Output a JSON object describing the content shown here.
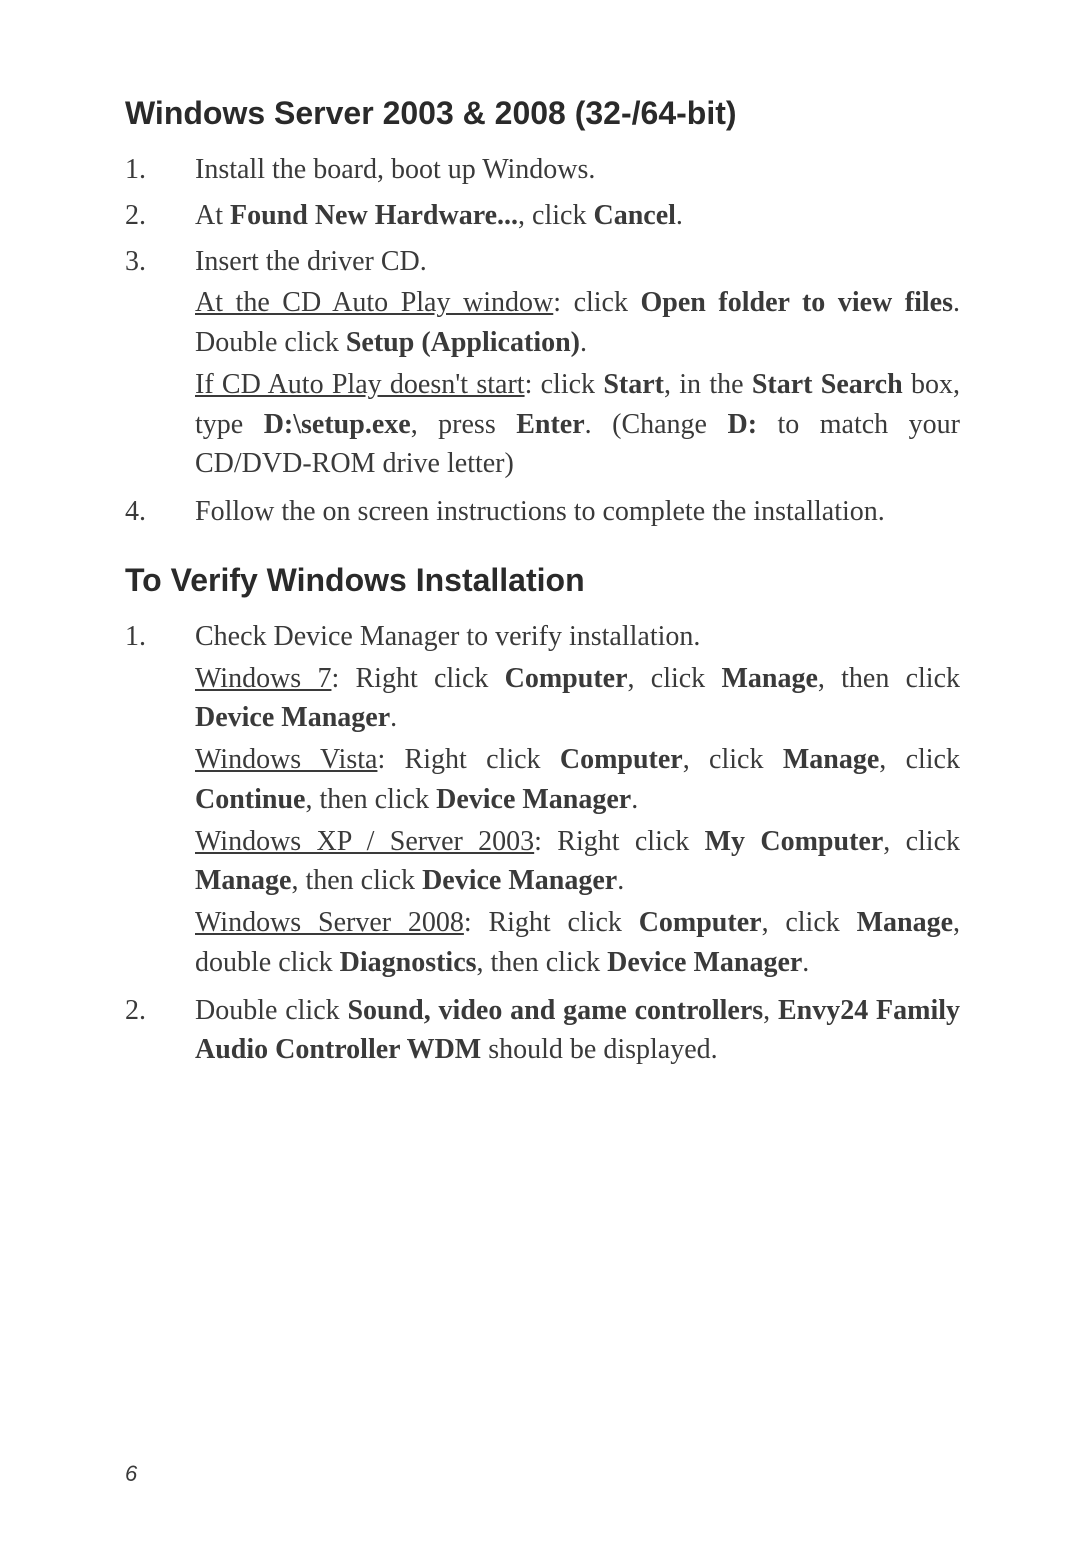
{
  "heading1": "Windows Server 2003 & 2008 (32-/64-bit)",
  "list1": {
    "item1": {
      "num": "1.",
      "text": "Install the board, boot up Windows."
    },
    "item2": {
      "num": "2.",
      "prefix": "At ",
      "bold1": "Found New Hardware...",
      "mid": ", click ",
      "bold2": "Cancel",
      "suffix": "."
    },
    "item3": {
      "num": "3.",
      "line1": "Insert the driver CD.",
      "line2_u": "At the CD Auto Play window",
      "line2_a": ": click ",
      "line2_b1": "Open folder to view files",
      "line2_c": ".  Double click ",
      "line2_b2": "Setup (Application)",
      "line2_d": ".",
      "line3_u": "If CD Auto Play doesn't start",
      "line3_a": ": click ",
      "line3_b1": "Start",
      "line3_b": ", in the ",
      "line3_b2": "Start Search",
      "line3_c": " box, type ",
      "line3_b3": "D:\\setup.exe",
      "line3_d": ", press ",
      "line3_b4": "Enter",
      "line3_e": ". (Change ",
      "line3_b5": "D:",
      "line3_f": " to match your CD/DVD-ROM drive letter)"
    },
    "item4": {
      "num": "4.",
      "text": "Follow the on screen instructions to complete the installation."
    }
  },
  "heading2": "To Verify Windows Installation",
  "list2": {
    "item1": {
      "num": "1.",
      "line1": "Check Device Manager to verify installation.",
      "w7_u": "Windows 7",
      "w7_a": ": Right click ",
      "w7_b1": "Computer",
      "w7_b": ", click ",
      "w7_b2": "Manage",
      "w7_c": ", then click ",
      "w7_b3": "Device Manager",
      "w7_d": ".",
      "wv_u": "Windows Vista",
      "wv_a": ": Right click ",
      "wv_b1": "Computer",
      "wv_b": ", click ",
      "wv_b2": "Manage",
      "wv_c": ", click ",
      "wv_b3": "Continue",
      "wv_d": ", then click ",
      "wv_b4": "Device Manager",
      "wv_e": ".",
      "wxp_u": "Windows XP / Server 2003",
      "wxp_a": ": Right click ",
      "wxp_b1": "My Computer",
      "wxp_b": ", click ",
      "wxp_b2": "Manage",
      "wxp_c": ", then click ",
      "wxp_b3": "Device Manager",
      "wxp_d": ".",
      "ws_u": "Windows Server 2008",
      "ws_a": ": Right click ",
      "ws_b1": "Computer",
      "ws_b": ", click ",
      "ws_b2": "Manage",
      "ws_c": ", double click ",
      "ws_b3": "Diagnostics",
      "ws_d": ", then click ",
      "ws_b4": "Device Manager",
      "ws_e": "."
    },
    "item2": {
      "num": "2.",
      "a": "Double click ",
      "b1": "Sound, video and game controllers",
      "b": ", ",
      "b2": "Envy24 Family Audio Controller WDM",
      "c": " should be  displayed."
    }
  },
  "pageNumber": "6"
}
